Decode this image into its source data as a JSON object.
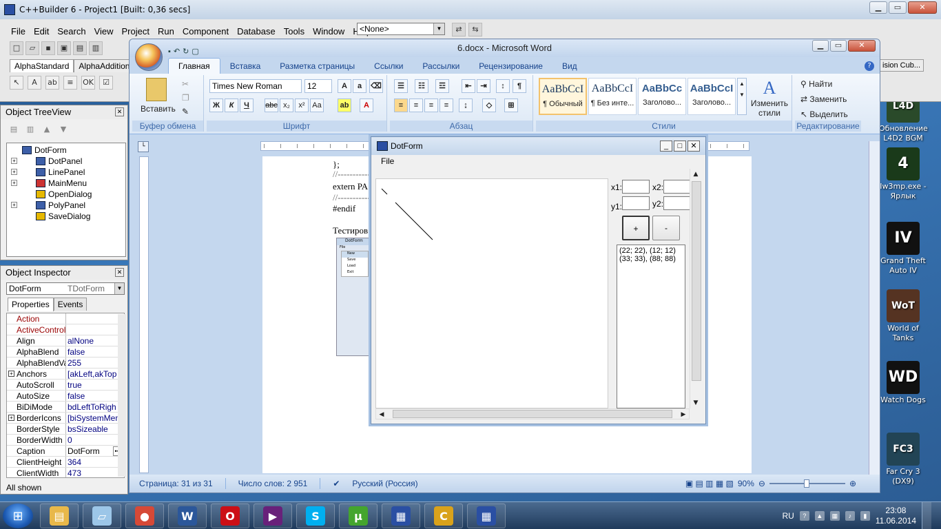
{
  "cbuilder": {
    "title": "C++Builder 6 - Project1 [Built: 0,36 secs]",
    "menu": [
      "File",
      "Edit",
      "Search",
      "View",
      "Project",
      "Run",
      "Component",
      "Database",
      "Tools",
      "Window",
      "Help"
    ],
    "config_combo": "<None>",
    "palette_tabs": [
      "AlphaStandard",
      "AlphaAdditional"
    ],
    "right_palette_tab": "ision Cub..."
  },
  "treeview": {
    "title": "Object TreeView",
    "items": [
      {
        "label": "DotForm",
        "level": 0,
        "expandable": false,
        "kind": "form"
      },
      {
        "label": "DotPanel",
        "level": 1,
        "expandable": true,
        "kind": "panel"
      },
      {
        "label": "LinePanel",
        "level": 1,
        "expandable": true,
        "kind": "panel"
      },
      {
        "label": "MainMenu",
        "level": 1,
        "expandable": true,
        "kind": "menu"
      },
      {
        "label": "OpenDialog",
        "level": 1,
        "expandable": false,
        "kind": "dialog"
      },
      {
        "label": "PolyPanel",
        "level": 1,
        "expandable": true,
        "kind": "panel"
      },
      {
        "label": "SaveDialog",
        "level": 1,
        "expandable": false,
        "kind": "dialog"
      }
    ]
  },
  "inspector": {
    "title": "Object Inspector",
    "object_name": "DotForm",
    "object_type": "TDotForm",
    "tabs": [
      "Properties",
      "Events"
    ],
    "props": [
      {
        "k": "Action",
        "v": "",
        "ev": true
      },
      {
        "k": "ActiveControl",
        "v": "",
        "ev": true
      },
      {
        "k": "Align",
        "v": "alNone"
      },
      {
        "k": "AlphaBlend",
        "v": "false"
      },
      {
        "k": "AlphaBlendValu",
        "v": "255"
      },
      {
        "k": "Anchors",
        "v": "[akLeft,akTop",
        "plus": true
      },
      {
        "k": "AutoScroll",
        "v": "true"
      },
      {
        "k": "AutoSize",
        "v": "false"
      },
      {
        "k": "BiDiMode",
        "v": "bdLeftToRigh"
      },
      {
        "k": "BorderIcons",
        "v": "[biSystemMen",
        "plus": true
      },
      {
        "k": "BorderStyle",
        "v": "bsSizeable"
      },
      {
        "k": "BorderWidth",
        "v": "0"
      },
      {
        "k": "Caption",
        "v": "DotForm",
        "sel": true
      },
      {
        "k": "ClientHeight",
        "v": "364"
      },
      {
        "k": "ClientWidth",
        "v": "473"
      }
    ],
    "status": "All shown"
  },
  "word": {
    "title": "6.docx - Microsoft Word",
    "tabs": [
      "Главная",
      "Вставка",
      "Разметка страницы",
      "Ссылки",
      "Рассылки",
      "Рецензирование",
      "Вид"
    ],
    "groups": {
      "clipboard": "Буфер обмена",
      "font": "Шрифт",
      "paragraph": "Абзац",
      "styles": "Стили",
      "editing": "Редактирование"
    },
    "paste_label": "Вставить",
    "font_name": "Times New Roman",
    "font_size": "12",
    "styles": [
      {
        "sample": "AaBbCcI",
        "name": "¶ Обычный"
      },
      {
        "sample": "AaBbCcI",
        "name": "¶ Без инте..."
      },
      {
        "sample": "AaBbCc",
        "name": "Заголово..."
      },
      {
        "sample": "AaBbCcI",
        "name": "Заголово..."
      }
    ],
    "change_styles": "Изменить стили",
    "find": "Найти",
    "replace": "Заменить",
    "select": "Выделить",
    "doc_lines": [
      "};",
      "//------------",
      "extern PA",
      "//------------",
      "#endif",
      "Тестиров"
    ],
    "thumb_menu": {
      "title": "DotForm",
      "menu": "File",
      "items": [
        "New",
        "Save",
        "Load",
        "Exit"
      ]
    },
    "status": {
      "page": "Страница: 31 из 31",
      "words": "Число слов: 2 951",
      "lang": "Русский (Россия)",
      "zoom": "90%"
    }
  },
  "dotform": {
    "title": "DotForm",
    "menu": "File",
    "x1_label": "x1:",
    "x2_label": "x2:",
    "y1_label": "y1:",
    "y2_label": "y2:",
    "plus": "+",
    "minus": "-",
    "memo": [
      "(22; 22), (12; 12)",
      "(33; 33), (88; 88)"
    ]
  },
  "desktop_icons": [
    {
      "label": "Обновление L4D2 BGM",
      "glyph": "L4D",
      "color": "#2a4a2a"
    },
    {
      "label": "Iw3mp.exe - Ярлык",
      "glyph": "4",
      "color": "#1a3a1a"
    },
    {
      "label": "Grand Theft Auto IV",
      "glyph": "IV",
      "color": "#111111"
    },
    {
      "label": "World of Tanks",
      "glyph": "WoT",
      "color": "#553322"
    },
    {
      "label": "Watch Dogs",
      "glyph": "WD",
      "color": "#111111"
    },
    {
      "label": "Far Cry 3 (DX9)",
      "glyph": "FC3",
      "color": "#224455"
    }
  ],
  "taskbar": {
    "apps": [
      {
        "name": "explorer",
        "glyph": "▤",
        "color": "#e8b84a"
      },
      {
        "name": "notes",
        "glyph": "▱",
        "color": "#9cc6e8"
      },
      {
        "name": "chrome",
        "glyph": "●",
        "color": "#d64937"
      },
      {
        "name": "word",
        "glyph": "W",
        "color": "#2b579a"
      },
      {
        "name": "opera",
        "glyph": "O",
        "color": "#cc0f16"
      },
      {
        "name": "vs",
        "glyph": "▶",
        "color": "#68217a"
      },
      {
        "name": "skype",
        "glyph": "S",
        "color": "#00aff0"
      },
      {
        "name": "utorrent",
        "glyph": "µ",
        "color": "#44a52e"
      },
      {
        "name": "dotform-app",
        "glyph": "▦",
        "color": "#2a4fa3"
      },
      {
        "name": "cbuilder",
        "glyph": "C",
        "color": "#d9a21b"
      },
      {
        "name": "project-app",
        "glyph": "▦",
        "color": "#2a4fa3"
      }
    ],
    "lang": "RU",
    "time": "23:08",
    "date": "11.06.2014"
  }
}
